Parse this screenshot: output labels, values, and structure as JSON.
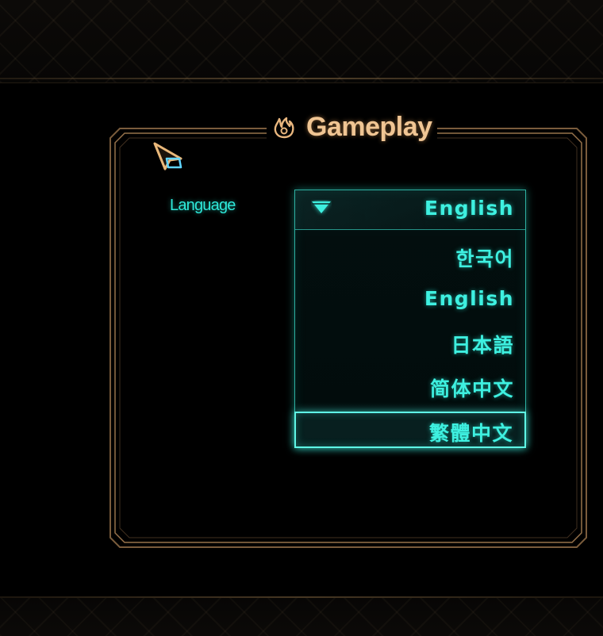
{
  "panel": {
    "title": "Gameplay",
    "title_icon": "flame-icon"
  },
  "settings": {
    "language_label": "Language",
    "language_dropdown": {
      "selected": "English",
      "options": [
        "한국어",
        "English",
        "日本語",
        "简体中文",
        "繁體中文"
      ],
      "highlighted_index": 4
    }
  },
  "colors": {
    "accent_cyan": "#3ef0e0",
    "title_gold": "#f0c593",
    "frame_gold": "#8a6a45",
    "background": "#000000"
  }
}
